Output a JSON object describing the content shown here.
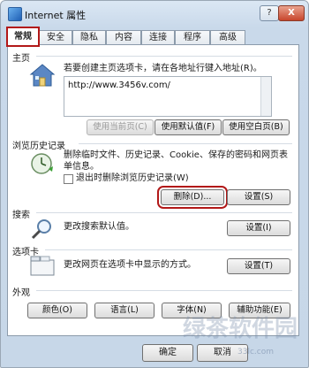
{
  "window": {
    "title": "Internet 属性",
    "help": "?",
    "close": "X"
  },
  "tabs": [
    "常规",
    "安全",
    "隐私",
    "内容",
    "连接",
    "程序",
    "高级"
  ],
  "home": {
    "section": "主页",
    "description": "若要创建主页选项卡，请在各地址行键入地址(R)。",
    "url": "http://www.3456v.com/",
    "use_current": "使用当前页(C)",
    "use_default": "使用默认值(F)",
    "use_blank": "使用空白页(B)"
  },
  "history": {
    "section": "浏览历史记录",
    "description": "删除临时文件、历史记录、Cookie、保存的密码和网页表单信息。",
    "exit_delete": "退出时删除浏览历史记录(W)",
    "delete": "删除(D)...",
    "settings": "设置(S)"
  },
  "search": {
    "section": "搜索",
    "description": "更改搜索默认值。",
    "settings": "设置(I)"
  },
  "tabbing": {
    "section": "选项卡",
    "description": "更改网页在选项卡中显示的方式。",
    "settings": "设置(T)"
  },
  "appearance": {
    "section": "外观",
    "buttons": [
      "颜色(O)",
      "语言(L)",
      "字体(N)",
      "辅助功能(E)"
    ]
  },
  "footer": {
    "ok": "确定",
    "cancel": "取消"
  },
  "watermark": {
    "text": "绿茶软件园",
    "url": "33lc.com"
  },
  "colors": {
    "highlight_red": "#b21818",
    "title_bg": "#c9d9ea"
  }
}
